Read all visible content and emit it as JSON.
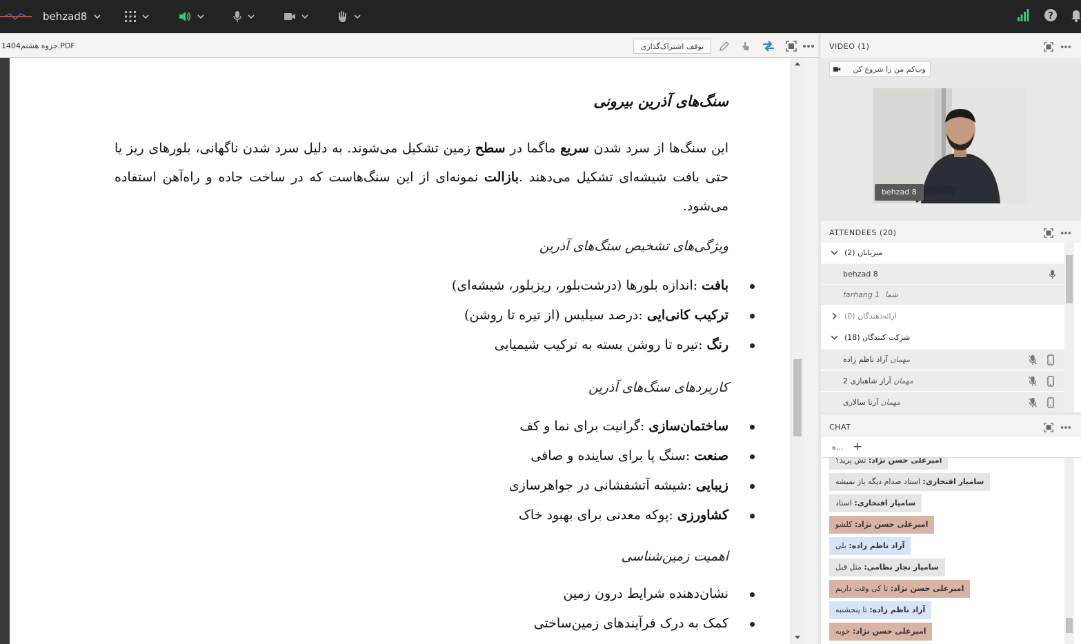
{
  "topbar": {
    "username": "behzad8"
  },
  "share": {
    "file_name": "جزوه هشتم1404.PDF",
    "stop_sharing_label": "توقف اشتراک‌گذاری"
  },
  "document": {
    "heading": "سنگ‌های آذرین بیرونی",
    "paragraph": "این سنگ‌ها از سرد شدن سریع ماگما در سطح زمین تشکیل می‌شوند. به دلیل سرد شدن ناگهانی، بلورهای ریز یا حتی بافت شیشه‌ای تشکیل می‌دهند .بازالت نمونه‌ای از این سنگ‌هاست که در ساخت جاده و راه‌آهن استفاده می‌شود.",
    "section1_title": "ویژگی‌های تشخیص سنگ‌های آذرین",
    "section1_items": [
      {
        "term": "بافت",
        "desc": " :اندازه بلورها (درشت‌بلور، ریزبلور، شیشه‌ای)"
      },
      {
        "term": "ترکیب کانی‌ایی",
        "desc": " :درصد سیلیس (از تیره تا روشن)"
      },
      {
        "term": "رنگ",
        "desc": " :تیره تا روشن بسته به ترکیب شیمیایی"
      }
    ],
    "section2_title": "کاربردهای سنگ‌های آذرین",
    "section2_items": [
      {
        "term": "ساختمان‌سازی",
        "desc": " :گرانیت برای نما و کف"
      },
      {
        "term": "صنعت",
        "desc": " :سنگ پا برای ساینده و صافی"
      },
      {
        "term": "زیبایی",
        "desc": " :شیشه آتشفشانی در جواهرسازی"
      },
      {
        "term": "کشاورزی",
        "desc": " :پوکه معدنی برای بهبود خاک"
      }
    ],
    "section3_title": "اهمیت زمین‌شناسی",
    "section3_items": [
      "نشان‌دهنده شرایط درون زمین",
      "کمک به درک فرآیندهای زمین‌ساختی"
    ]
  },
  "video": {
    "title": "VIDEO (1)",
    "webcam_button": "وب‌کم من را شروع کن",
    "presenter_tag": "behzad 8"
  },
  "attendees": {
    "title": "ATTENDEES  (20)",
    "hosts_label": "میزبانان (2)",
    "hosts": [
      {
        "name": "behzad 8",
        "role": ""
      },
      {
        "name": "farhang 1",
        "role": "شما"
      }
    ],
    "presenters_label": "ارائه‌دهندگان (0)",
    "participants_label": "شرکت کنندگان (18)",
    "participants": [
      {
        "role": "مهمان",
        "name": "آراد ناظم زاده"
      },
      {
        "role": "مهمان",
        "name": "آراز شاهبازی 2"
      },
      {
        "role": "مهمان",
        "name": "آرتا سالاری"
      }
    ]
  },
  "chat": {
    "title": "CHAT",
    "tab_label": "ه...",
    "messages": [
      {
        "author": "امیرعلی حسن نژاد:",
        "text": " تش پرید؟",
        "style": "gray"
      },
      {
        "author": "سامیار افتخاری:",
        "text": " استاد صدام دیگه باز نمیشه",
        "style": "gray"
      },
      {
        "author": "سامیار افتخاری:",
        "text": " استاد",
        "style": "gray"
      },
      {
        "author": "امیرعلی حسن نژاد:",
        "text": " کلشو",
        "style": "tan"
      },
      {
        "author": "آراد ناظم زاده:",
        "text": " بلی",
        "style": "blue"
      },
      {
        "author": "سامیار نجار نظامی:",
        "text": " مثل قبل",
        "style": "gray"
      },
      {
        "author": "امیرعلی حسن نژاد:",
        "text": " تا کی وقت داریم",
        "style": "tan"
      },
      {
        "author": "آراد ناظم زاده:",
        "text": " تا پنجشنبه",
        "style": "blue"
      },
      {
        "author": "امیرعلی حسن نژاد:",
        "text": " خوبه",
        "style": "tan"
      }
    ]
  },
  "colors": {
    "topbar_bg": "#232323",
    "speaker_active": "#3ec46d",
    "signal_bars": "#3ec46d",
    "share_arrows": "#2a7fd4"
  }
}
